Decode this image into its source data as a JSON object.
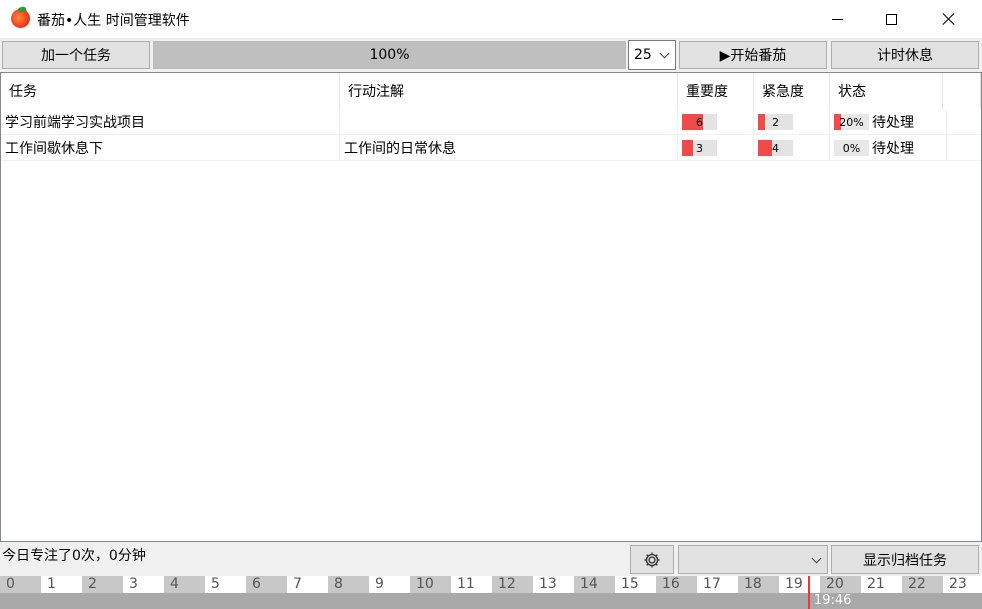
{
  "window": {
    "title": "番茄•人生 时间管理软件"
  },
  "toolbar": {
    "add_task_label": "加一个任务",
    "progress": {
      "text": "100%",
      "fraction": 1.0
    },
    "minutes_select": {
      "value": "25"
    },
    "start_label": "▶开始番茄",
    "rest_label": "计时休息"
  },
  "table": {
    "headers": {
      "task": "任务",
      "note": "行动注解",
      "importance": "重要度",
      "urgency": "紧急度",
      "status": "状态"
    },
    "rows": [
      {
        "task": "学习前端学习实战项目",
        "note": "",
        "importance": {
          "text": "6",
          "fraction": 0.6
        },
        "urgency": {
          "text": "2",
          "fraction": 0.2
        },
        "progress": {
          "text": "20%",
          "fraction": 0.2
        },
        "status": "待处理"
      },
      {
        "task": "工作间歇休息下",
        "note": "工作间的日常休息",
        "importance": {
          "text": "3",
          "fraction": 0.3
        },
        "urgency": {
          "text": "4",
          "fraction": 0.4
        },
        "progress": {
          "text": "0%",
          "fraction": 0.0
        },
        "status": "待处理"
      }
    ]
  },
  "footer": {
    "focus_summary": "今日专注了0次，0分钟",
    "settings_icon": "gear-icon",
    "archive_label": "显示归档任务"
  },
  "timeline": {
    "hours": [
      "0",
      "1",
      "2",
      "3",
      "4",
      "5",
      "6",
      "7",
      "8",
      "9",
      "10",
      "11",
      "12",
      "13",
      "14",
      "15",
      "16",
      "17",
      "18",
      "19",
      "20",
      "21",
      "22",
      "23"
    ],
    "current_time": "19:46"
  },
  "colors": {
    "accent_red": "#f04a4a",
    "now_line": "#ff3030",
    "toolbar_bg": "#f0f0f0"
  }
}
